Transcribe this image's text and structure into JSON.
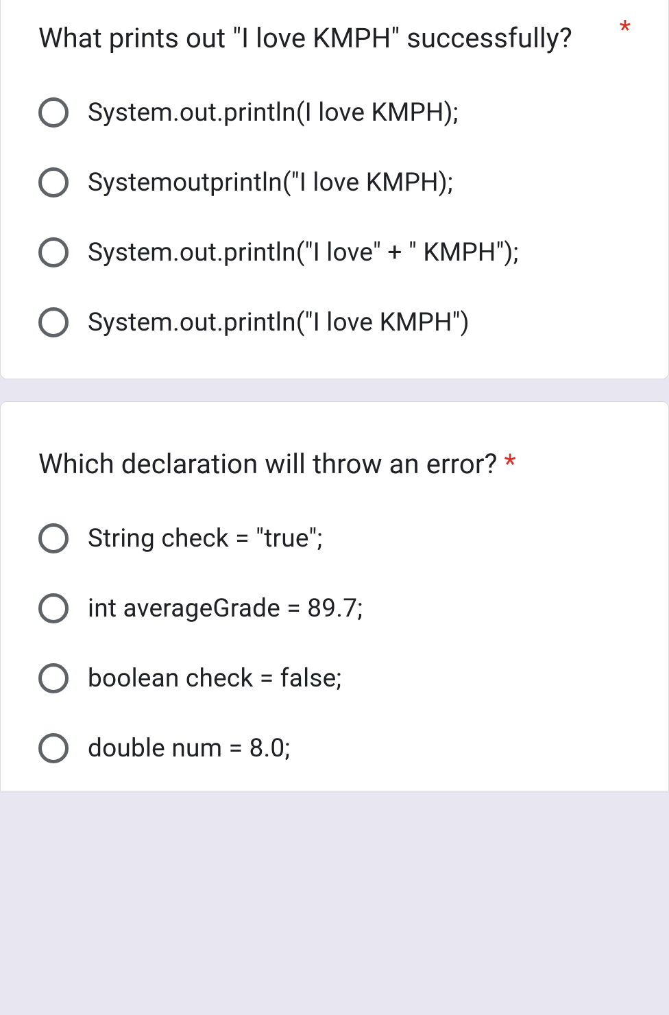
{
  "questions": [
    {
      "text": "What prints out \"I love KMPH\" successfully?",
      "required": "*",
      "inlineRequired": false,
      "options": [
        "System.out.println(I love KMPH);",
        "Systemoutprintln(\"I love KMPH);",
        "System.out.println(\"I love\" + \" KMPH\");",
        "System.out.println(\"I love KMPH\")"
      ]
    },
    {
      "text": "Which declaration will throw an error? ",
      "required": "*",
      "inlineRequired": true,
      "options": [
        "String check = \"true\";",
        "int averageGrade = 89.7;",
        "boolean check = false;",
        "double num = 8.0;"
      ]
    }
  ]
}
